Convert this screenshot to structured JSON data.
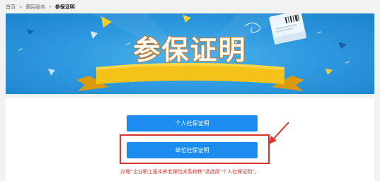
{
  "breadcrumb": {
    "home": "首页",
    "separator": ">",
    "service": "便民服务",
    "current": "参保证明"
  },
  "banner": {
    "title": "参保证明",
    "colors": {
      "sky": "#2f9be0",
      "ribbon": "#f5c21a",
      "title_fill": "#ffffff"
    }
  },
  "buttons": {
    "personal": "个人社保证明",
    "unit": "单位社保证明"
  },
  "notice": "办理“企业职工基本养老保险关系转移”请选择“个人社保证明”。",
  "annotation": {
    "color": "#d9342b"
  }
}
